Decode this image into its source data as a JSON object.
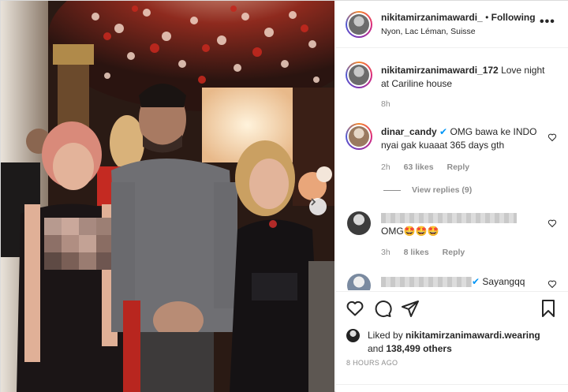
{
  "post": {
    "username": "nikitamirzanimawardi_",
    "separator": "•",
    "follow_label": "Following",
    "location": "Nyon, Lac Léman, Suisse",
    "more_icon": "more-options-icon",
    "more_label": "•••"
  },
  "comments": [
    {
      "username": "nikitamirzanimawardi_172",
      "text": "Love night at Cariline house",
      "time": "8h"
    },
    {
      "username": "dinar_candy",
      "text": "OMG bawa ke INDO nyai gak kuaaat 365 days gth",
      "time": "2h",
      "likes": "63 likes",
      "reply_label": "Reply",
      "view_replies": "View replies (9)"
    },
    {
      "username": "",
      "text": "OMG🤩🤩🤩",
      "time": "3h",
      "likes": "8 likes",
      "reply_label": "Reply"
    },
    {
      "username": "",
      "text": "Sayangqq"
    }
  ],
  "actions": {
    "like_icon": "heart-icon",
    "comment_icon": "comment-icon",
    "share_icon": "share-icon",
    "save_icon": "bookmark-icon"
  },
  "likes_summary": {
    "prefix": "Liked by",
    "user": "nikitamirzanimawardi.wearing",
    "and": "and",
    "count": "138,499 others"
  },
  "timestamp": "8 HOURS AGO"
}
